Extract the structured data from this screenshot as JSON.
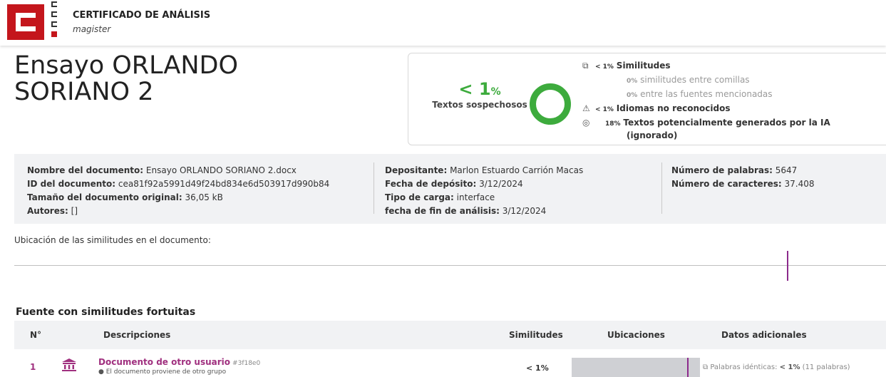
{
  "brand": {
    "title": "CERTIFICADO DE ANÁLISIS",
    "subtitle": "magister",
    "logo_color": "#c4161c"
  },
  "document": {
    "title": "Ensayo ORLANDO SORIANO 2"
  },
  "summary": {
    "percent_value": "< 1",
    "percent_unit": "%",
    "label": "Textos sospechosos",
    "accent_color": "#3dab3d",
    "rows": [
      {
        "icon": "copy-icon",
        "pct": "< 1%",
        "text": "Similitudes",
        "muted": false
      },
      {
        "icon": "",
        "pct": "0%",
        "text": "similitudes entre comillas",
        "muted": true
      },
      {
        "icon": "",
        "pct": "0%",
        "text": "entre las fuentes mencionadas",
        "muted": true
      },
      {
        "icon": "warning-language-icon",
        "pct": "< 1%",
        "text": "Idiomas no reconocidos",
        "muted": false
      },
      {
        "icon": "ai-icon",
        "pct": "18%",
        "text": "Textos potencialmente generados por la IA",
        "muted": false
      },
      {
        "icon": "",
        "pct": "",
        "text": "(ignorado)",
        "muted": false
      }
    ]
  },
  "info": {
    "col1": [
      {
        "label": "Nombre del documento:",
        "value": "Ensayo ORLANDO SORIANO 2.docx"
      },
      {
        "label": "ID del documento:",
        "value": "cea81f92a5991d49f24bd834e6d503917d990b84"
      },
      {
        "label": "Tamaño del documento original:",
        "value": "36,05 kB"
      },
      {
        "label": "Autores:",
        "value": "[]"
      }
    ],
    "col2": [
      {
        "label": "Depositante:",
        "value": "Marlon Estuardo Carrión Macas"
      },
      {
        "label": "Fecha de depósito:",
        "value": "3/12/2024"
      },
      {
        "label": "Tipo de carga:",
        "value": "interface"
      },
      {
        "label": "fecha de fin de análisis:",
        "value": "3/12/2024"
      }
    ],
    "col3": [
      {
        "label": "Número de palabras:",
        "value": "5647"
      },
      {
        "label": "Número de caracteres:",
        "value": "37.408"
      }
    ]
  },
  "location": {
    "label": "Ubicación de las similitudes en el documento:",
    "marker_color": "#8c2a8c"
  },
  "sources": {
    "title": "Fuente con similitudes fortuitas",
    "headers": {
      "num": "N°",
      "desc": "Descripciones",
      "sim": "Similitudes",
      "loc": "Ubicaciones",
      "extra": "Datos adicionales"
    },
    "rows": [
      {
        "num": "1",
        "title": "Documento de otro usuario",
        "id": "#3f18e0",
        "sub": "El documento proviene de otro grupo",
        "similarity": "< 1%",
        "extra_label": "Palabras idénticas:",
        "extra_value": "< 1%",
        "extra_count": "(11 palabras)"
      }
    ]
  }
}
